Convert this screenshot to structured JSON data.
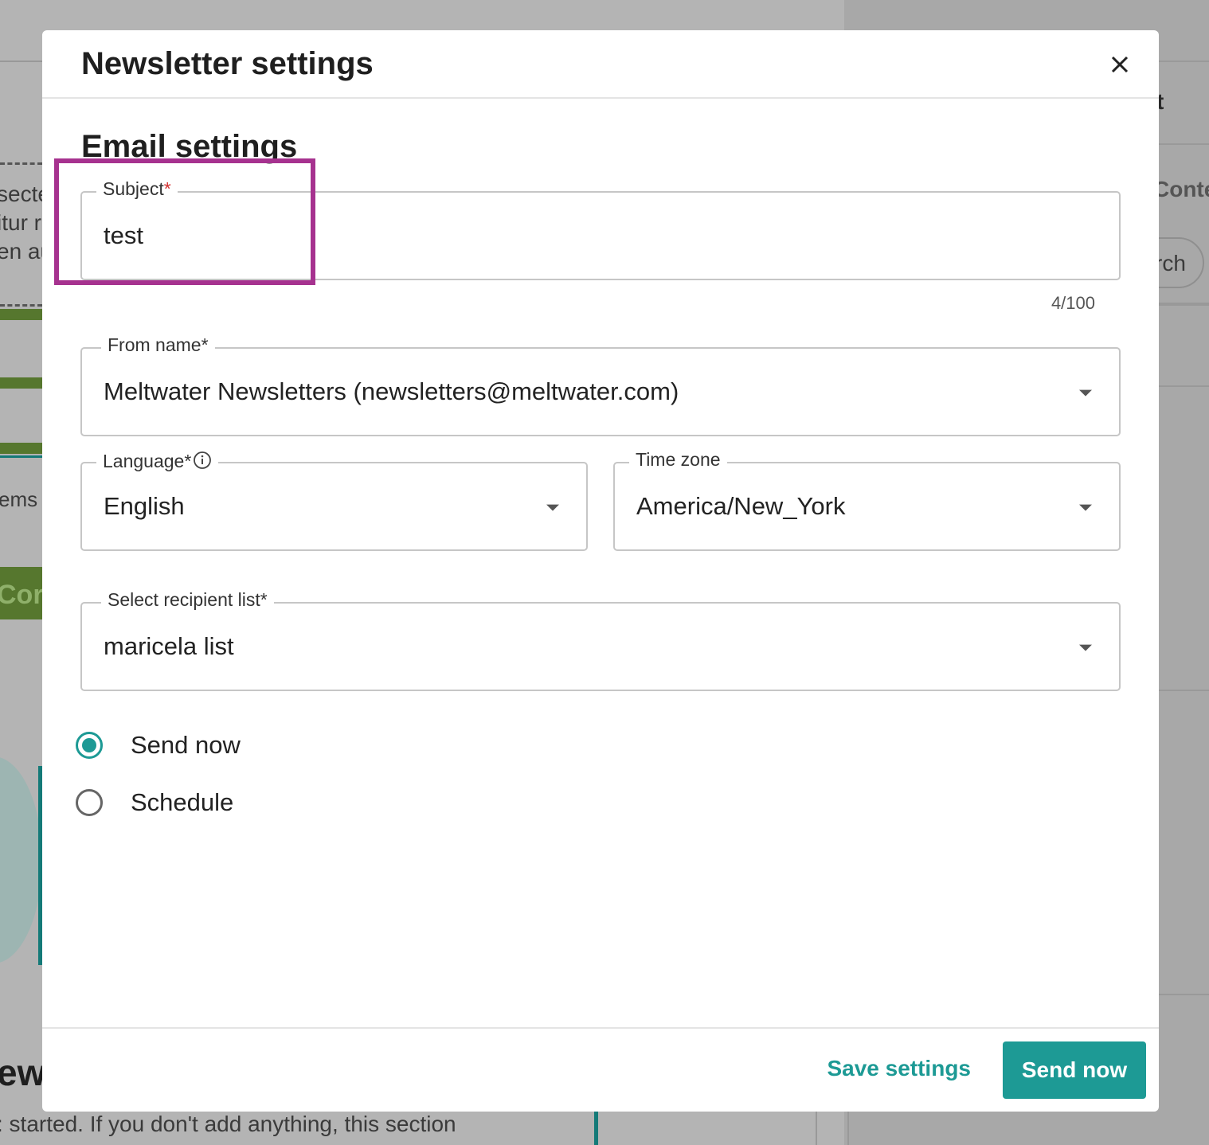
{
  "background": {
    "left_fragments": [
      "secte",
      "itur r",
      "en au",
      "ems",
      "Corp",
      "ew"
    ],
    "bottom_text": ": started. If you don't add anything, this section",
    "right_fragments": [
      "t",
      "Conte",
      "rch"
    ]
  },
  "modal": {
    "title": "Newsletter settings",
    "section_title": "Email settings",
    "subject": {
      "label": "Subject",
      "required_mark": "*",
      "value": "test",
      "counter": "4/100"
    },
    "from_name": {
      "label": "From name*",
      "value": "Meltwater Newsletters (newsletters@meltwater.com)"
    },
    "language": {
      "label": "Language*",
      "value": "English"
    },
    "time_zone": {
      "label": "Time zone",
      "value": "America/New_York"
    },
    "recipient_list": {
      "label": "Select recipient list*",
      "value": "maricela list"
    },
    "send_options": [
      {
        "label": "Send now",
        "selected": true
      },
      {
        "label": "Schedule",
        "selected": false
      }
    ],
    "footer": {
      "save_label": "Save settings",
      "send_label": "Send now"
    }
  },
  "colors": {
    "accent": "#1d9a95",
    "highlight": "#a6328f",
    "required": "#d32f2f"
  }
}
